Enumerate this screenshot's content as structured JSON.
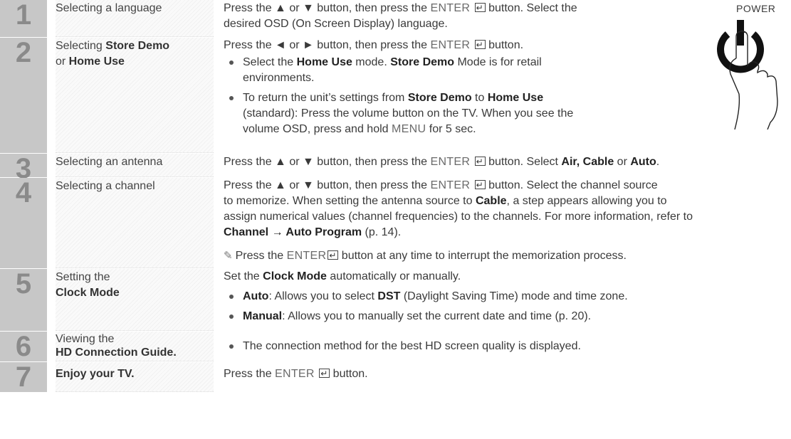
{
  "power": {
    "label": "POWER",
    "icon": "power-hand-icon"
  },
  "enter_button": {
    "label": "ENTER",
    "icon": "enter-icon"
  },
  "steps": [
    {
      "number": "1",
      "label": "Selecting a language",
      "text_a": "Press the ▲ or ▼ button, then press the ",
      "text_b": " button. Select the",
      "text_c": "desired OSD (On Screen Display) language."
    },
    {
      "number": "2",
      "label_a": "Selecting ",
      "label_b": "Store Demo",
      "label_c": "or ",
      "label_d": "Home Use",
      "text_a": "Press the ◄ or ► button, then press the ",
      "text_b": " button.",
      "bullet1_a": "Select the ",
      "bullet1_b": "Home Use",
      "bullet1_c": " mode. ",
      "bullet1_d": "Store Demo",
      "bullet1_e": " Mode is for retail",
      "bullet1_f": "environments.",
      "bullet2_a": "To return the unit’s settings from ",
      "bullet2_b": "Store Demo",
      "bullet2_c": " to ",
      "bullet2_d": "Home Use",
      "bullet2_e": "(standard): Press the volume button on the TV. When you see the",
      "bullet2_f": "volume OSD, press and hold ",
      "bullet2_g": "MENU",
      "bullet2_h": " for 5 sec."
    },
    {
      "number": "3",
      "label": "Selecting an antenna",
      "text_a": "Press the ▲ or ▼ button, then press the ",
      "text_b": " button. Select ",
      "text_c": "Air, Cable",
      "text_d": " or ",
      "text_e": "Auto",
      "text_f": "."
    },
    {
      "number": "4",
      "label": "Selecting a channel",
      "text_a": "Press the ▲ or ▼ button, then press the ",
      "text_b": " button. Select the channel source",
      "text_c": "to memorize. When setting the antenna source to ",
      "text_d": "Cable",
      "text_e": ", a step appears allowing you to",
      "text_f": "assign numerical values (channel frequencies) to the channels. For more information, refer to",
      "text_g": "Channel → Auto Program",
      "text_h": " (p. 14).",
      "note_a": "Press the ",
      "note_b": " button at any time to interrupt the memorization process."
    },
    {
      "number": "5",
      "label_a": "Setting the",
      "label_b": "Clock Mode",
      "text_a": "Set the ",
      "text_b": "Clock Mode",
      "text_c": " automatically or manually.",
      "bullet1_a": "Auto",
      "bullet1_b": ": Allows you to select ",
      "bullet1_c": "DST",
      "bullet1_d": " (Daylight Saving Time) mode and time zone.",
      "bullet2_a": "Manual",
      "bullet2_b": ": Allows you to manually set the current date and time (p. 20)."
    },
    {
      "number": "6",
      "label_a": "Viewing the",
      "label_b": "HD Connection Guide.",
      "bullet1": "The connection method for the best HD screen quality is displayed."
    },
    {
      "number": "7",
      "label": "Enjoy your TV.",
      "text_a": "Press the ",
      "text_b": " button."
    }
  ]
}
